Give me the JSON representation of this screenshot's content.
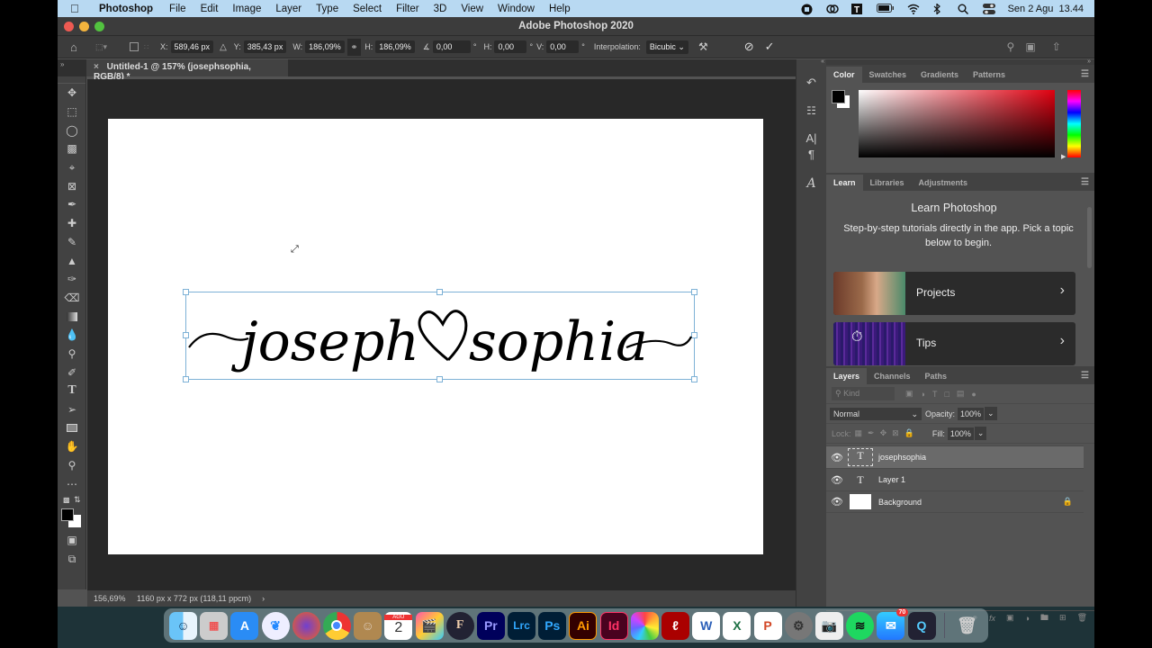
{
  "menubar": {
    "app_name": "Photoshop",
    "items": [
      "File",
      "Edit",
      "Image",
      "Layer",
      "Type",
      "Select",
      "Filter",
      "3D",
      "View",
      "Window",
      "Help"
    ],
    "status_icons": [
      "stop-icon",
      "creative-cloud-icon",
      "text-app-icon",
      "battery-icon",
      "wifi-icon",
      "bluetooth-icon",
      "spotlight-icon",
      "control-center-icon"
    ],
    "datetime": "Sen 2 Agu  13.44"
  },
  "window": {
    "title": "Adobe Photoshop 2020"
  },
  "options": {
    "x_label": "X:",
    "x_value": "589,46 px",
    "y_label": "Y:",
    "y_value": "385,43 px",
    "w_label": "W:",
    "w_value": "186,09%",
    "h_label": "H:",
    "h_value": "186,09%",
    "angle_value": "0,00",
    "angle_unit": "°",
    "hskew_label": "H:",
    "hskew_value": "0,00",
    "vskew_label": "V:",
    "vskew_value": "0,00",
    "interp_label": "Interpolation:",
    "interp_value": "Bicubic"
  },
  "document": {
    "tab_title": "Untitled-1 @ 157% (josephsophia, RGB/8) *",
    "canvas_text_left": "joseph",
    "canvas_text_right": "sophia",
    "zoom": "156,69%",
    "doc_info": "1160 px x 772 px (118,11 ppcm)"
  },
  "color_panel": {
    "tabs": [
      "Color",
      "Swatches",
      "Gradients",
      "Patterns"
    ],
    "foreground": "#000000",
    "background": "#ffffff",
    "hue_color": "#e00010"
  },
  "learn_panel": {
    "tabs": [
      "Learn",
      "Libraries",
      "Adjustments"
    ],
    "title": "Learn Photoshop",
    "description": "Step-by-step tutorials directly in the app. Pick a topic below to begin.",
    "cards": [
      {
        "label": "Projects"
      },
      {
        "label": "Tips"
      }
    ]
  },
  "layers_panel": {
    "tabs": [
      "Layers",
      "Channels",
      "Paths"
    ],
    "filter_placeholder": "Kind",
    "blend_mode": "Normal",
    "opacity_label": "Opacity:",
    "opacity_value": "100%",
    "lock_label": "Lock:",
    "fill_label": "Fill:",
    "fill_value": "100%",
    "layers": [
      {
        "name": "josephsophia",
        "type": "text",
        "selected": true
      },
      {
        "name": "Layer 1",
        "type": "text",
        "selected": false
      },
      {
        "name": "Background",
        "type": "image",
        "locked": true
      }
    ]
  },
  "dock": {
    "calendar_month": "AGU",
    "calendar_day": "2",
    "mail_badge": "70",
    "apps": [
      "Finder",
      "Launchpad",
      "App Store",
      "Safari",
      "Firefox",
      "Chrome",
      "Contacts",
      "Calendar",
      "Final Cut Pro",
      "Fontself",
      "Premiere Pro",
      "Lightroom Classic",
      "Photoshop",
      "Illustrator",
      "InDesign",
      "Photos",
      "Acrobat",
      "Word",
      "Excel",
      "PowerPoint",
      "System Preferences",
      "Screenshot",
      "Spotify",
      "Mail",
      "QuickTime Player",
      "Trash"
    ],
    "labels": {
      "pr": "Pr",
      "lrc": "Lrc",
      "ps": "Ps",
      "ai": "Ai",
      "id": "Id",
      "word": "W",
      "excel": "X",
      "ppt": "P",
      "fontself": "F"
    }
  }
}
